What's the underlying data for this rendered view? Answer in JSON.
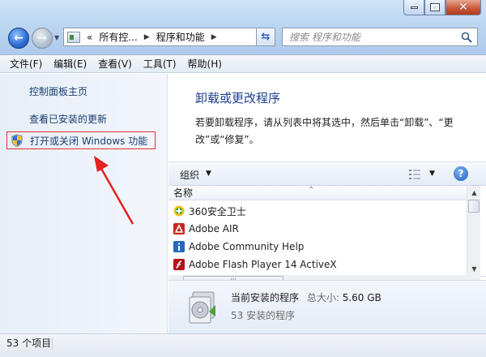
{
  "address": {
    "overflow": "«",
    "segments": [
      "所有控...",
      "程序和功能"
    ],
    "separator": "▶"
  },
  "search": {
    "placeholder": "搜索 程序和功能"
  },
  "menu": [
    "文件(F)",
    "编辑(E)",
    "查看(V)",
    "工具(T)",
    "帮助(H)"
  ],
  "tasks": {
    "home": "控制面板主页",
    "updates": "查看已安装的更新",
    "windows_features": "打开或关闭 Windows 功能"
  },
  "main": {
    "title": "卸载或更改程序",
    "description": "若要卸载程序，请从列表中将其选中，然后单击“卸载”、“更改”或“修复”。"
  },
  "toolbar": {
    "organize": "组织"
  },
  "list": {
    "column_name": "名称",
    "rows": [
      {
        "name": "360安全卫士",
        "icon": "360-icon"
      },
      {
        "name": "Adobe AIR",
        "icon": "adobe-air-icon"
      },
      {
        "name": "Adobe Community Help",
        "icon": "adobe-help-icon"
      },
      {
        "name": "Adobe Flash Player 14 ActiveX",
        "icon": "flash-player-icon"
      }
    ]
  },
  "details": {
    "label": "当前安装的程序",
    "size_label": "总大小:",
    "size_value": "5.60 GB",
    "count": "53 安装的程序"
  },
  "status": {
    "items": "53 个项目"
  },
  "colors": {
    "accent": "#1e3e8f",
    "highlight_border": "#e03131",
    "link": "#1a3e6e"
  }
}
